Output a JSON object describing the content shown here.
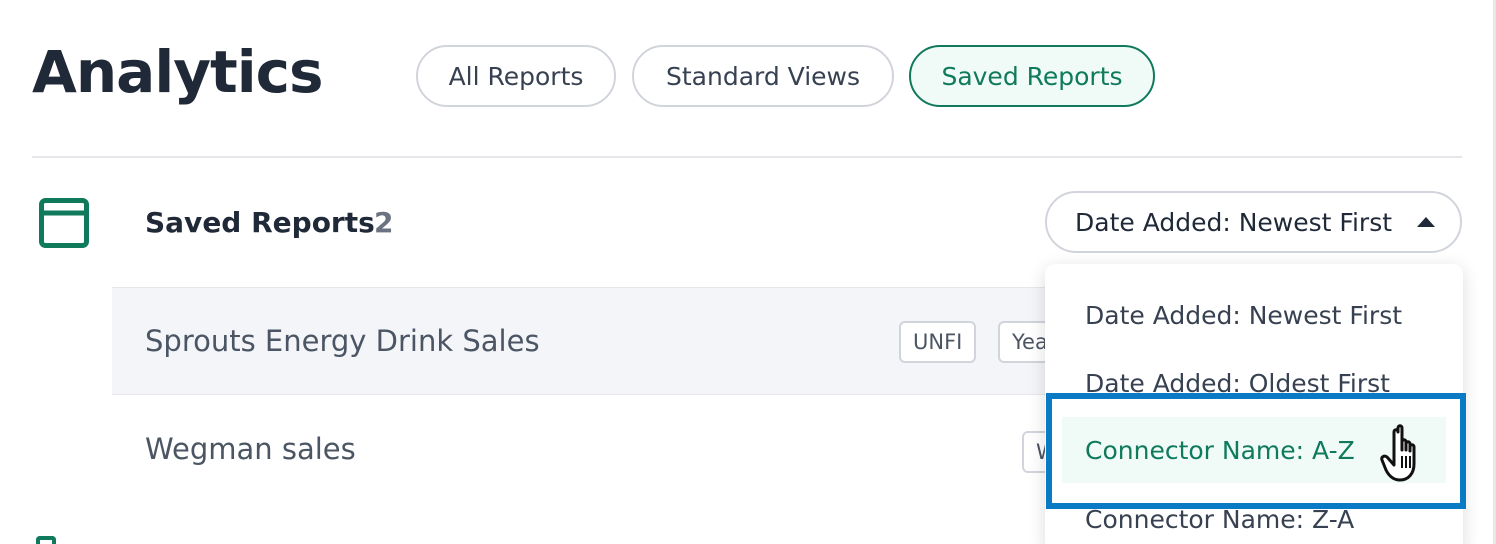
{
  "header": {
    "title": "Analytics",
    "tabs": [
      {
        "label": "All Reports",
        "active": false
      },
      {
        "label": "Standard Views",
        "active": false
      },
      {
        "label": "Saved Reports",
        "active": true
      }
    ]
  },
  "section": {
    "title": "Saved Reports",
    "count": "2",
    "icon": "window-icon"
  },
  "sort": {
    "selected": "Date Added: Newest First",
    "options": [
      "Date Added: Newest First",
      "Date Added: Oldest First",
      "Connector Name: A-Z",
      "Connector Name: Z-A"
    ],
    "hovered_index": 2
  },
  "reports": [
    {
      "name": "Sprouts Energy Drink Sales",
      "tags": [
        "UNFI",
        "Yea"
      ]
    },
    {
      "name": "Wegman sales",
      "tags": [
        "W"
      ]
    }
  ],
  "colors": {
    "accent": "#0f7a5c",
    "highlight": "#0a7ac4",
    "text": "#1f2937",
    "muted": "#6b7280"
  }
}
